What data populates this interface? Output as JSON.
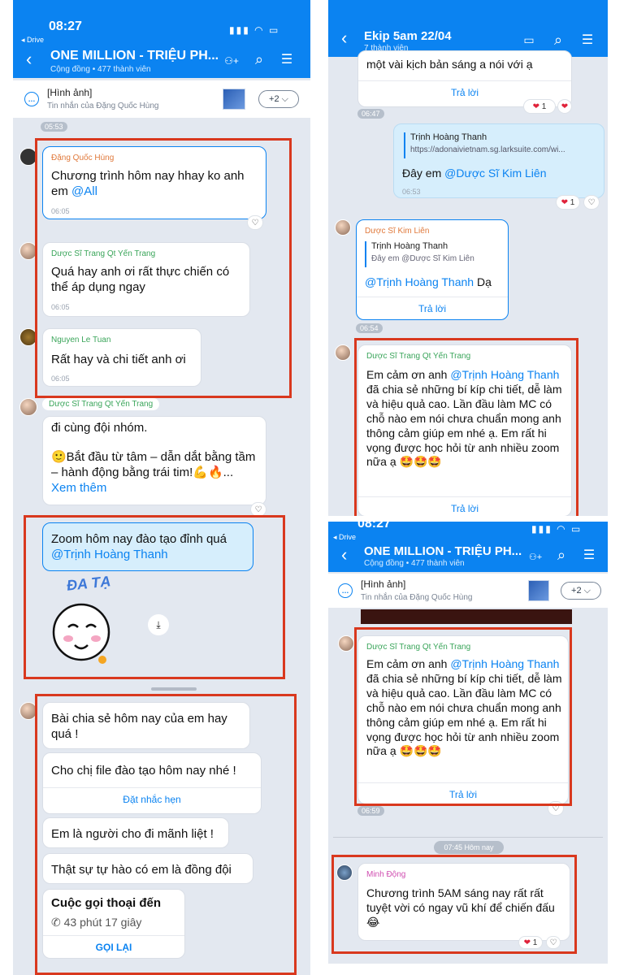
{
  "left": {
    "status": {
      "time": "08:27",
      "back": "◂ Drive"
    },
    "header": {
      "title": "ONE MILLION - TRIỆU PH...",
      "subtitle": "Cộng đồng • 477 thành viên"
    },
    "pinned": {
      "title": "[Hình ảnh]",
      "sub": "Tin nhắn của Đặng Quốc Hùng",
      "more": "+2"
    },
    "ts_top": "05:53",
    "m1": {
      "sender": "Đặng Quốc Hùng",
      "text": "Chương trình hôm nay hhay ko anh em ",
      "mention": "@All",
      "time": "06:05"
    },
    "m2": {
      "sender": "Dược Sĩ Trang Qt Yến Trang",
      "text": "Quá hay anh ơi rất thực chiến có thể áp dụng ngay",
      "time": "06:05"
    },
    "m3": {
      "sender": "Nguyen Le Tuan",
      "text": "Rất hay và chi tiết anh ơi",
      "time": "06:05"
    },
    "m4": {
      "sender": "Dược Sĩ Trang Qt Yến Trang",
      "line1": "đi cùng đội nhóm.",
      "text": "🙂Bắt đầu từ tâm – dẫn dắt bằng tầm – hành động bằng trái tim!💪🔥... ",
      "more": "Xem thêm"
    },
    "m5": {
      "text": "Zoom hôm nay đào tạo đỉnh quá ",
      "mention": "@Trịnh Hoàng Thanh"
    },
    "sticker": {
      "caption": "ĐA TẠ"
    },
    "m6": {
      "text": "Bài chia sẻ hôm nay của em hay quá !"
    },
    "m7": {
      "text": "Cho chị file đào tạo hôm nay nhé !",
      "action": "Đặt nhắc hẹn"
    },
    "m8": {
      "text": "Em là người cho đi mãnh liệt !"
    },
    "m9": {
      "text": "Thật sự tự hào có em là đồng đội"
    },
    "call": {
      "title": "Cuộc gọi thoại đến",
      "duration": "43 phút 17 giây",
      "action": "GỌI LẠI"
    }
  },
  "rt": {
    "header": {
      "title": "Ekip 5am 22/04",
      "subtitle": "7 thành viên"
    },
    "m1": {
      "text": "một vài kịch bản sáng a nói với ạ",
      "reply": "Trả lời",
      "react": "1",
      "time": "06:47"
    },
    "m2": {
      "quote_name": "Trịnh Hoàng Thanh",
      "quote_link": "https://adonaivietnam.sg.larksuite.com/wi...",
      "text": "Đây em ",
      "mention": "@Dược Sĩ Kim Liên",
      "time": "06:53",
      "react": "1"
    },
    "m3": {
      "sender": "Dược Sĩ Kim Liên",
      "quote_name": "Trịnh Hoàng Thanh",
      "quote_text": "Đây em @Dược Sĩ Kim Liên",
      "mention": "@Trịnh Hoàng Thanh",
      "text": " Dạ",
      "reply": "Trả lời",
      "time": "06:54"
    },
    "m4": {
      "sender": "Dược Sĩ Trang Qt Yến Trang",
      "pre": "Em cảm ơn anh ",
      "mention": "@Trịnh Hoàng Thanh",
      "text": " đã chia sẻ những bí kíp chi tiết, dễ làm và hiệu quả cao. Lần đầu làm MC có chỗ nào em nói chưa chuẩn mong anh thông cảm giúp em nhé ạ. Em rất hi vọng được học hỏi từ anh nhiều zoom nữa ạ 🤩🤩🤩",
      "reply": "Trả lời"
    }
  },
  "rb": {
    "status": {
      "time": "08:27",
      "back": "◂ Drive"
    },
    "header": {
      "title": "ONE MILLION - TRIỆU PH...",
      "subtitle": "Cộng đồng • 477 thành viên"
    },
    "pinned": {
      "title": "[Hình ảnh]",
      "sub": "Tin nhắn của Đặng Quốc Hùng",
      "more": "+2"
    },
    "m1": {
      "sender": "Dược Sĩ Trang Qt Yến Trang",
      "pre": "Em cảm ơn anh ",
      "mention": "@Trịnh Hoàng Thanh",
      "text": " đã chia sẻ những bí kíp chi tiết, dễ làm và hiệu quả cao. Lần đầu làm MC có chỗ nào em nói chưa chuẩn mong anh thông cảm giúp em nhé ạ. Em rất hi vọng được học hỏi từ anh nhiều zoom nữa ạ 🤩🤩🤩",
      "reply": "Trả lời",
      "time": "06:59"
    },
    "day": "07:45 Hôm nay",
    "m2": {
      "sender": "Minh Động",
      "text": "Chương trình 5AM sáng nay rất rất tuyệt vời có ngay vũ khí để chiến đấu 😂",
      "react": "1"
    }
  }
}
